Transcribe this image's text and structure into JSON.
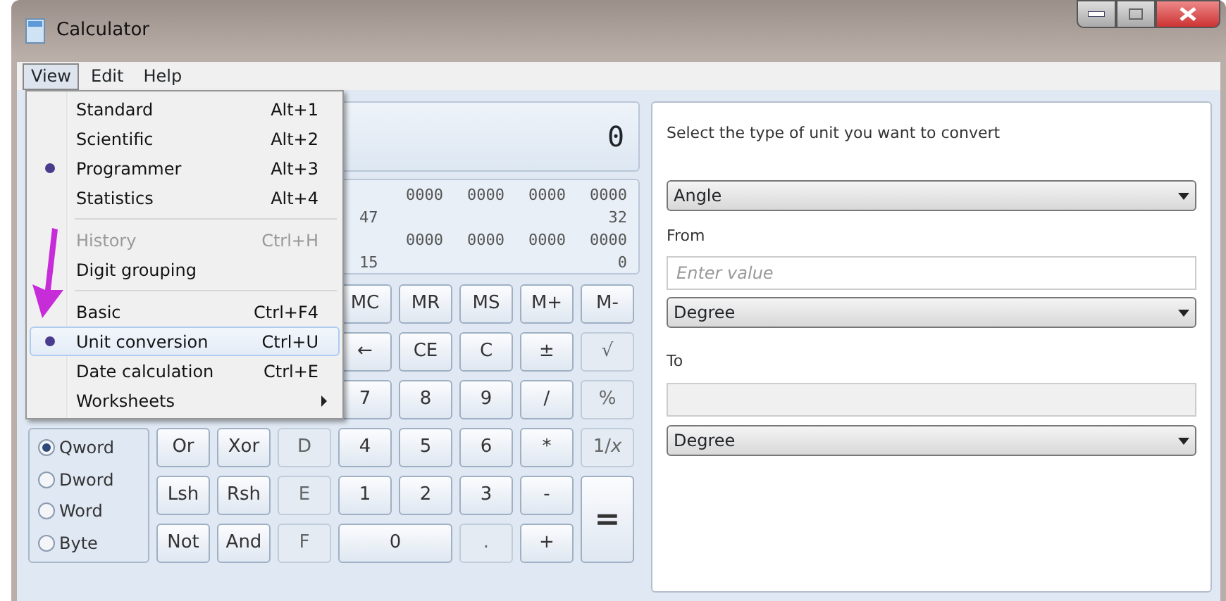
{
  "window": {
    "title": "Calculator"
  },
  "menu_bar": [
    {
      "label": "View",
      "selected": true
    },
    {
      "label": "Edit",
      "selected": false
    },
    {
      "label": "Help",
      "selected": false
    }
  ],
  "view_menu": [
    {
      "kind": "item",
      "label": "Standard",
      "shortcut": "Alt+1",
      "checked": false,
      "disabled": false,
      "highlighted": false
    },
    {
      "kind": "item",
      "label": "Scientific",
      "shortcut": "Alt+2",
      "checked": false,
      "disabled": false,
      "highlighted": false
    },
    {
      "kind": "item",
      "label": "Programmer",
      "shortcut": "Alt+3",
      "checked": true,
      "disabled": false,
      "highlighted": false
    },
    {
      "kind": "item",
      "label": "Statistics",
      "shortcut": "Alt+4",
      "checked": false,
      "disabled": false,
      "highlighted": false
    },
    {
      "kind": "separator"
    },
    {
      "kind": "item",
      "label": "History",
      "shortcut": "Ctrl+H",
      "checked": false,
      "disabled": true,
      "highlighted": false
    },
    {
      "kind": "item",
      "label": "Digit grouping",
      "checked": false,
      "disabled": false,
      "highlighted": false
    },
    {
      "kind": "separator"
    },
    {
      "kind": "item",
      "label": "Basic",
      "shortcut": "Ctrl+F4",
      "checked": false,
      "disabled": false,
      "highlighted": false
    },
    {
      "kind": "item",
      "label": "Unit conversion",
      "shortcut": "Ctrl+U",
      "checked": true,
      "disabled": false,
      "highlighted": true
    },
    {
      "kind": "item",
      "label": "Date calculation",
      "shortcut": "Ctrl+E",
      "checked": false,
      "disabled": false,
      "highlighted": false
    },
    {
      "kind": "submenu",
      "label": "Worksheets",
      "checked": false,
      "disabled": false,
      "highlighted": false
    }
  ],
  "calculator": {
    "display": "0",
    "bit_rows": [
      {
        "groups": [
          "0000",
          "0000",
          "0000",
          "0000"
        ],
        "start": "47",
        "end": "32"
      },
      {
        "groups": [
          "0000",
          "0000",
          "0000",
          "0000"
        ],
        "start": "15",
        "end": "0"
      }
    ],
    "word_sizes": [
      {
        "label": "Qword",
        "selected": true
      },
      {
        "label": "Dword",
        "selected": false
      },
      {
        "label": "Word",
        "selected": false
      },
      {
        "label": "Byte",
        "selected": false
      }
    ],
    "key_rows": [
      [
        {
          "label": "MC",
          "disabled": false
        },
        {
          "label": "MR",
          "disabled": false
        },
        {
          "label": "MS",
          "disabled": false
        },
        {
          "label": "M+",
          "disabled": false
        },
        {
          "label": "M-",
          "disabled": false
        }
      ],
      [
        {
          "label": "←",
          "disabled": false
        },
        {
          "label": "CE",
          "disabled": false
        },
        {
          "label": "C",
          "disabled": false
        },
        {
          "label": "±",
          "disabled": false
        },
        {
          "label": "√",
          "disabled": true
        }
      ],
      [
        {
          "label": "7",
          "disabled": false
        },
        {
          "label": "8",
          "disabled": false
        },
        {
          "label": "9",
          "disabled": false
        },
        {
          "label": "/",
          "disabled": false
        },
        {
          "label": "%",
          "disabled": true
        }
      ],
      [
        {
          "label": "Or",
          "disabled": false
        },
        {
          "label": "Xor",
          "disabled": false
        },
        {
          "label": "D",
          "disabled": true
        },
        {
          "label": "4",
          "disabled": false
        },
        {
          "label": "5",
          "disabled": false
        },
        {
          "label": "6",
          "disabled": false
        },
        {
          "label": "*",
          "disabled": false
        },
        {
          "label": "1/*x*",
          "disabled": true
        }
      ],
      [
        {
          "label": "Lsh",
          "disabled": false
        },
        {
          "label": "Rsh",
          "disabled": false
        },
        {
          "label": "E",
          "disabled": true
        },
        {
          "label": "1",
          "disabled": false
        },
        {
          "label": "2",
          "disabled": false
        },
        {
          "label": "3",
          "disabled": false
        },
        {
          "label": "-",
          "disabled": false
        },
        {
          "label": "=",
          "disabled": false,
          "tall": true
        }
      ],
      [
        {
          "label": "Not",
          "disabled": false
        },
        {
          "label": "And",
          "disabled": false
        },
        {
          "label": "F",
          "disabled": true
        },
        {
          "label": "0",
          "disabled": false,
          "wide": true
        },
        {
          "label": ".",
          "disabled": true
        },
        {
          "label": "+",
          "disabled": false
        }
      ]
    ]
  },
  "unit_conversion": {
    "prompt": "Select the type of unit you want to convert",
    "type": "Angle",
    "from_label": "From",
    "from_placeholder": "Enter value",
    "from_unit": "Degree",
    "to_label": "To",
    "to_unit": "Degree"
  }
}
